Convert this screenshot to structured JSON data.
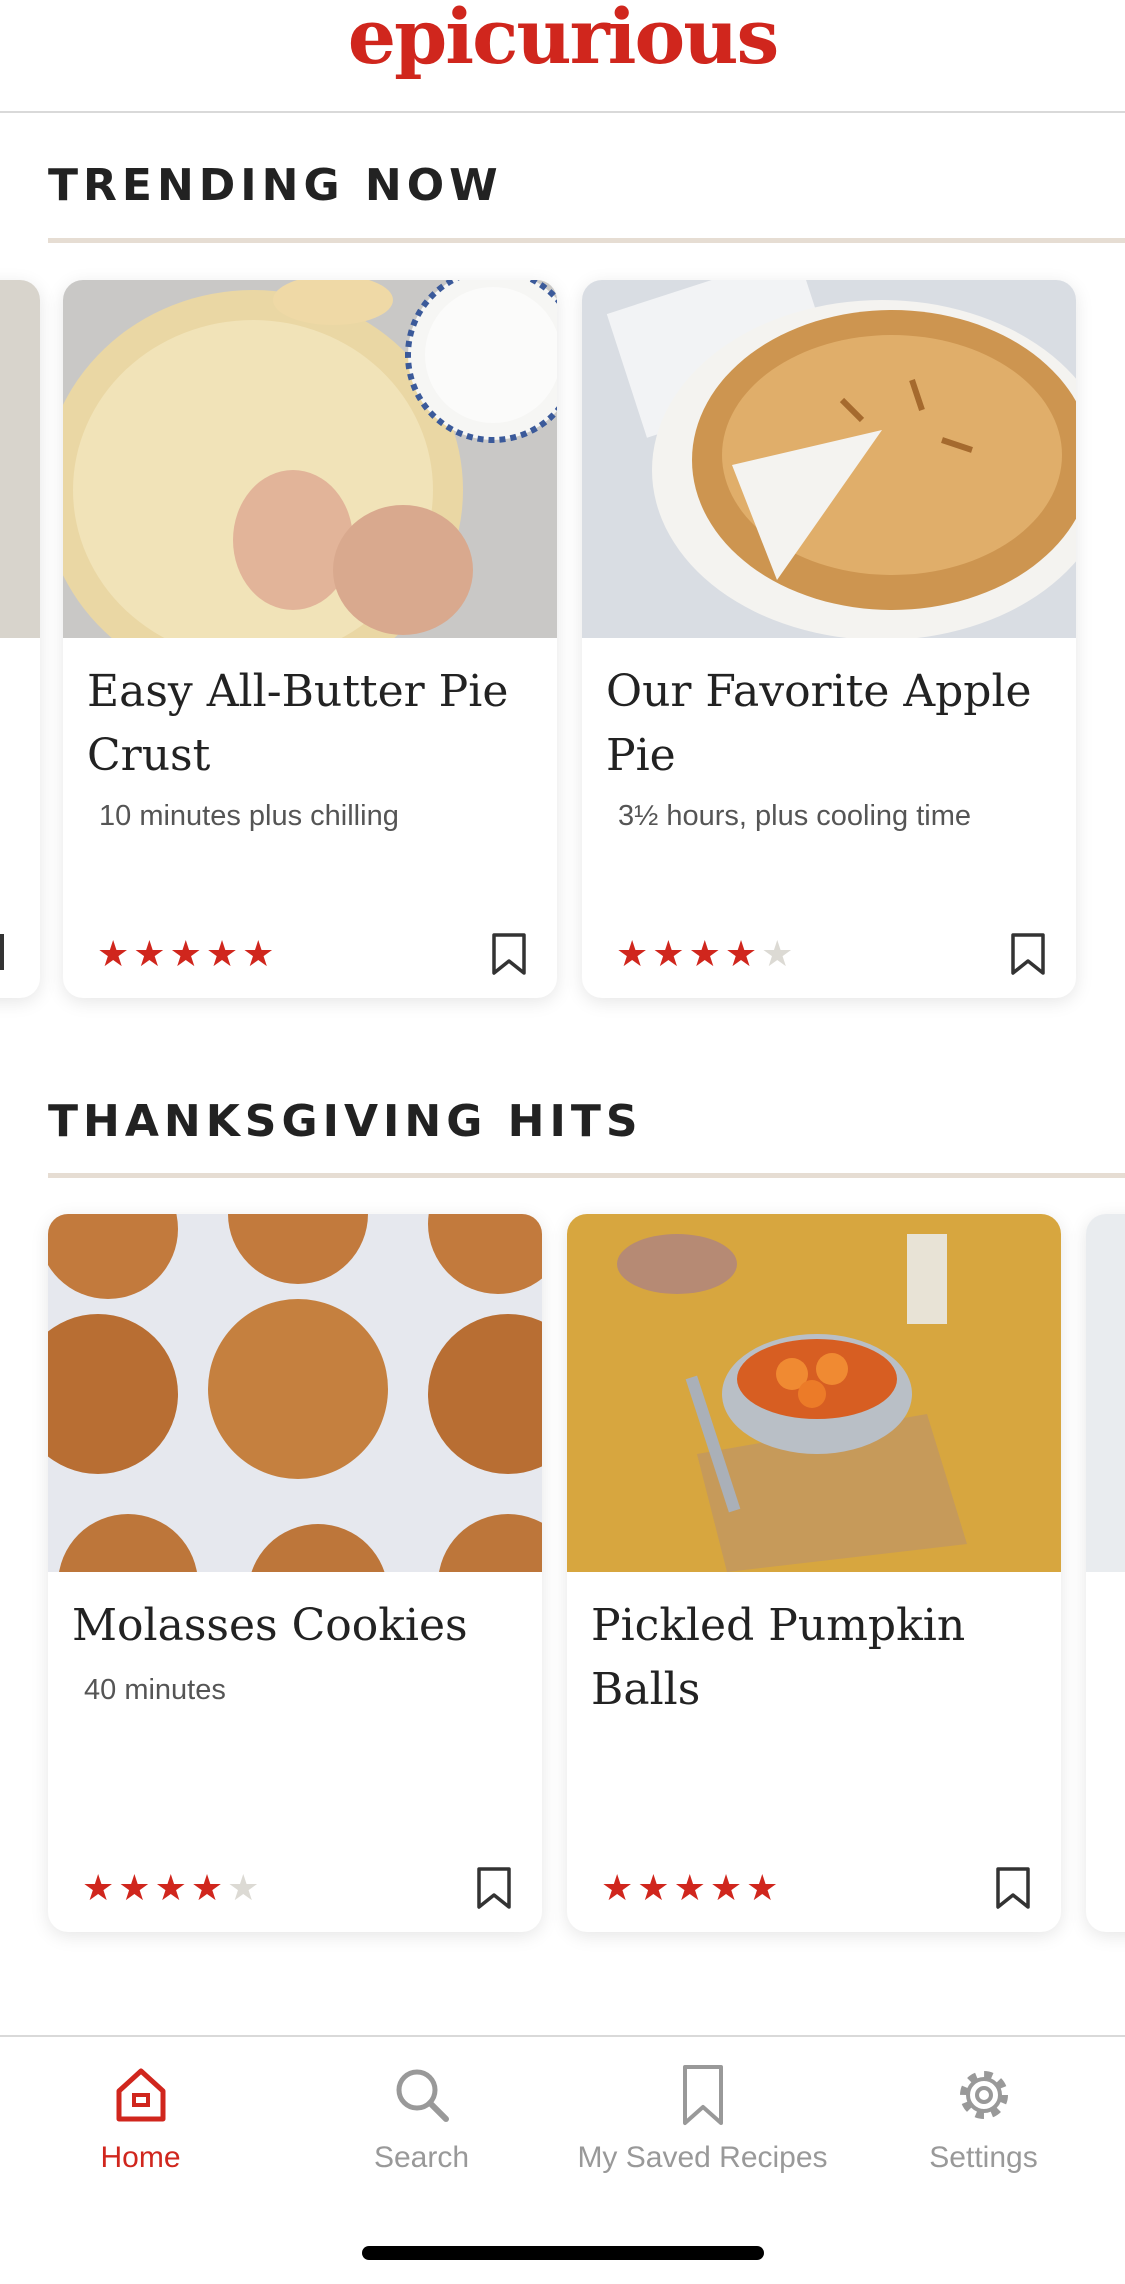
{
  "app": {
    "logo_text": "epicurious",
    "brand_color": "#d0261d"
  },
  "sections": [
    {
      "title": "TRENDING NOW",
      "cards": [
        {
          "title": "Easy All-Butter Pie Crust",
          "meta": "10 minutes plus chilling",
          "rating": 5,
          "bookmark_icon": "bookmark-icon"
        },
        {
          "title": "Our Favorite Apple Pie",
          "meta": "3½ hours, plus cooling time",
          "rating": 4,
          "bookmark_icon": "bookmark-icon"
        }
      ]
    },
    {
      "title": "THANKSGIVING HITS",
      "cards": [
        {
          "title": "Molasses Cookies",
          "meta": "40 minutes",
          "rating": 4,
          "bookmark_icon": "bookmark-icon"
        },
        {
          "title": "Pickled Pumpkin Balls",
          "meta": "",
          "rating": 5,
          "bookmark_icon": "bookmark-icon"
        }
      ]
    }
  ],
  "bottom_nav": [
    {
      "label": "Home",
      "icon": "home-icon",
      "active": true
    },
    {
      "label": "Search",
      "icon": "search-icon",
      "active": false
    },
    {
      "label": "My Saved Recipes",
      "icon": "bookmark-icon",
      "active": false
    },
    {
      "label": "Settings",
      "icon": "gear-icon",
      "active": false
    }
  ]
}
